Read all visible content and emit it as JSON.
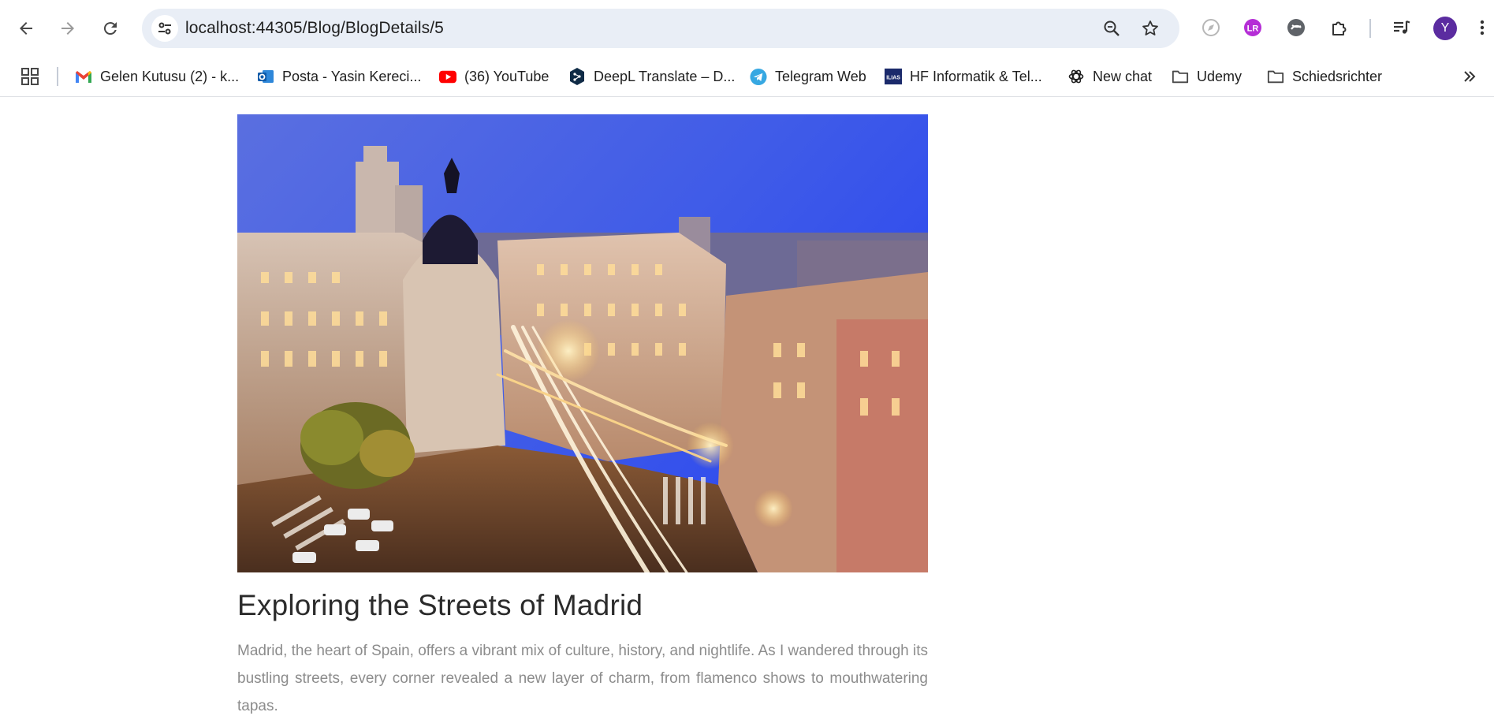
{
  "browser": {
    "url_host": "localhost",
    "url_path": ":44305/Blog/BlogDetails/5",
    "avatar_letter": "Y"
  },
  "bookmarks": [
    {
      "label": "Gelen Kutusu (2) - k...",
      "icon": "gmail-icon"
    },
    {
      "label": "Posta - Yasin Kereci...",
      "icon": "outlook-icon"
    },
    {
      "label": "(36) YouTube",
      "icon": "youtube-icon"
    },
    {
      "label": "DeepL Translate – D...",
      "icon": "deepl-icon"
    },
    {
      "label": "Telegram Web",
      "icon": "telegram-icon"
    },
    {
      "label": "HF Informatik & Tel...",
      "icon": "ilias-icon"
    },
    {
      "label": "New chat",
      "icon": "openai-icon"
    },
    {
      "label": "Udemy",
      "icon": "folder-icon"
    },
    {
      "label": "Schiedsrichter",
      "icon": "folder-icon"
    }
  ],
  "ilias_badge": "ILIAS",
  "post": {
    "title": "Exploring the Streets of Madrid",
    "body": "Madrid, the heart of Spain, offers a vibrant mix of culture, history, and nightlife. As I wandered through its bustling streets, every corner revealed a new layer of charm, from flamenco shows to mouthwatering tapas.",
    "image_alt": "Madrid Gran Via at night with the Metropolis building"
  },
  "colors": {
    "omnibox": "#e9eef6",
    "avatar": "#5b2ca0",
    "body_text": "#8c8c8c",
    "title_text": "#2b2b2b"
  }
}
